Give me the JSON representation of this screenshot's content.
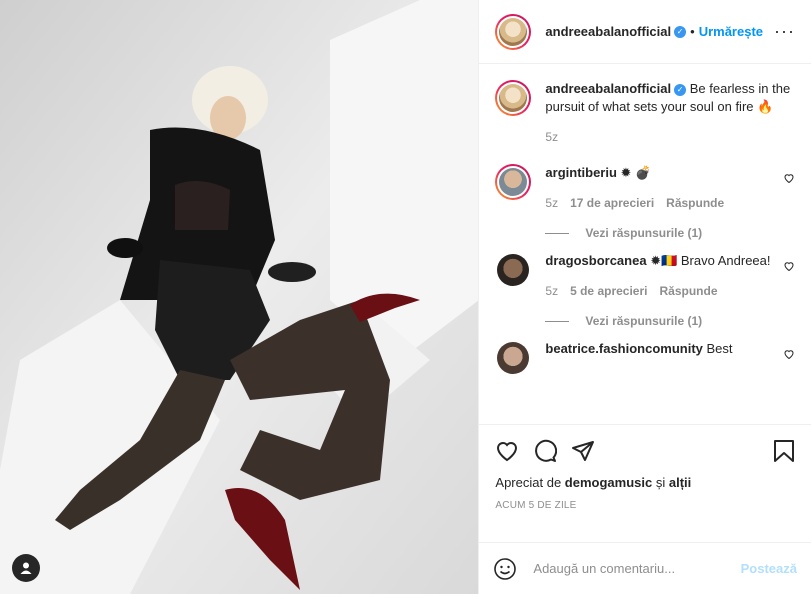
{
  "post": {
    "username": "andreeabalanofficial",
    "follow_label": "Urmărește",
    "separator": "•",
    "caption": "Be fearless in the pursuit of what sets your soul on fire 🔥",
    "caption_time": "5z"
  },
  "comments": [
    {
      "username": "argintiberiu",
      "text": "✹ 💣",
      "time": "5z",
      "likes": "17 de aprecieri",
      "reply_label": "Răspunde",
      "replies_label": "Vezi răspunsurile (1)"
    },
    {
      "username": "dragosborcanea",
      "text": "✹🇷🇴 Bravo Andreea!",
      "time": "5z",
      "likes": "5 de aprecieri",
      "reply_label": "Răspunde",
      "replies_label": "Vezi răspunsurile (1)"
    },
    {
      "username": "beatrice.fashioncomunity",
      "text": "Best"
    }
  ],
  "actions": {
    "liked_prefix": "Apreciat de",
    "liked_user": "demogamusic",
    "liked_and": "și",
    "liked_others": "alții",
    "time_ago": "ACUM 5 DE ZILE"
  },
  "add_comment": {
    "placeholder": "Adaugă un comentariu...",
    "post_label": "Postează"
  },
  "icons": [
    "user-tag-icon",
    "verified-icon",
    "more-icon",
    "heart-icon",
    "comment-icon",
    "share-icon",
    "bookmark-icon",
    "emoji-icon"
  ],
  "colors": {
    "accent": "#0095f6",
    "verified": "#3897f0",
    "post_disabled": "#b2dffc",
    "muted": "#8e8e8e"
  }
}
